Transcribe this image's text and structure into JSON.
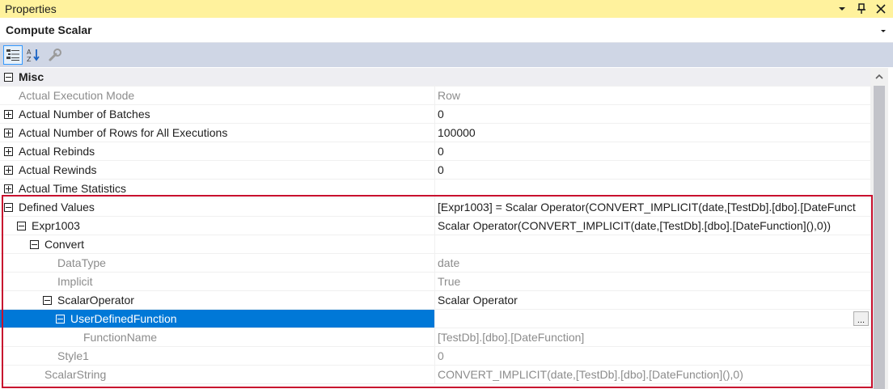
{
  "window": {
    "title": "Properties",
    "buttons": [
      "dropdown-icon",
      "pin-icon",
      "close-icon"
    ]
  },
  "object": {
    "name": "Compute Scalar"
  },
  "toolbar": {
    "tools": [
      "categorized-icon",
      "alphabetical-icon",
      "property-pages-icon"
    ]
  },
  "category": {
    "name": "Misc",
    "expanded": true
  },
  "rows": [
    {
      "name": "Actual Execution Mode",
      "value": "Row",
      "expander": "",
      "readonly": true
    },
    {
      "name": "Actual Number of Batches",
      "value": "0",
      "expander": "plus",
      "readonly": false
    },
    {
      "name": "Actual Number of Rows for All Executions",
      "value": "100000",
      "expander": "plus",
      "readonly": false
    },
    {
      "name": "Actual Rebinds",
      "value": "0",
      "expander": "plus",
      "readonly": false
    },
    {
      "name": "Actual Rewinds",
      "value": "0",
      "expander": "plus",
      "readonly": false
    },
    {
      "name": "Actual Time Statistics",
      "value": "",
      "expander": "plus",
      "readonly": false
    },
    {
      "name": "Defined Values",
      "value": "[Expr1003] = Scalar Operator(CONVERT_IMPLICIT(date,[TestDb].[dbo].[DateFunct",
      "expander": "minus",
      "readonly": false
    },
    {
      "name": "Expr1003",
      "value": "Scalar Operator(CONVERT_IMPLICIT(date,[TestDb].[dbo].[DateFunction](),0))",
      "expander": "minus",
      "readonly": false
    },
    {
      "name": "Convert",
      "value": "",
      "expander": "minus",
      "readonly": false
    },
    {
      "name": "DataType",
      "value": "date",
      "expander": "",
      "readonly": true
    },
    {
      "name": "Implicit",
      "value": "True",
      "expander": "",
      "readonly": true
    },
    {
      "name": "ScalarOperator",
      "value": "Scalar Operator",
      "expander": "minus",
      "readonly": false
    },
    {
      "name": "UserDefinedFunction",
      "value": "",
      "expander": "minus",
      "readonly": false,
      "selected": true,
      "ellipsis": "..."
    },
    {
      "name": "FunctionName",
      "value": "[TestDb].[dbo].[DateFunction]",
      "expander": "",
      "readonly": true
    },
    {
      "name": "Style1",
      "value": "0",
      "expander": "",
      "readonly": true
    },
    {
      "name": "ScalarString",
      "value": "CONVERT_IMPLICIT(date,[TestDb].[dbo].[DateFunction](),0)",
      "expander": "",
      "readonly": true
    }
  ],
  "colors": {
    "titlebar": "#fff29d",
    "toolbar": "#cfd6e5",
    "selection": "#0078d7",
    "highlight_border": "#c8102e"
  }
}
